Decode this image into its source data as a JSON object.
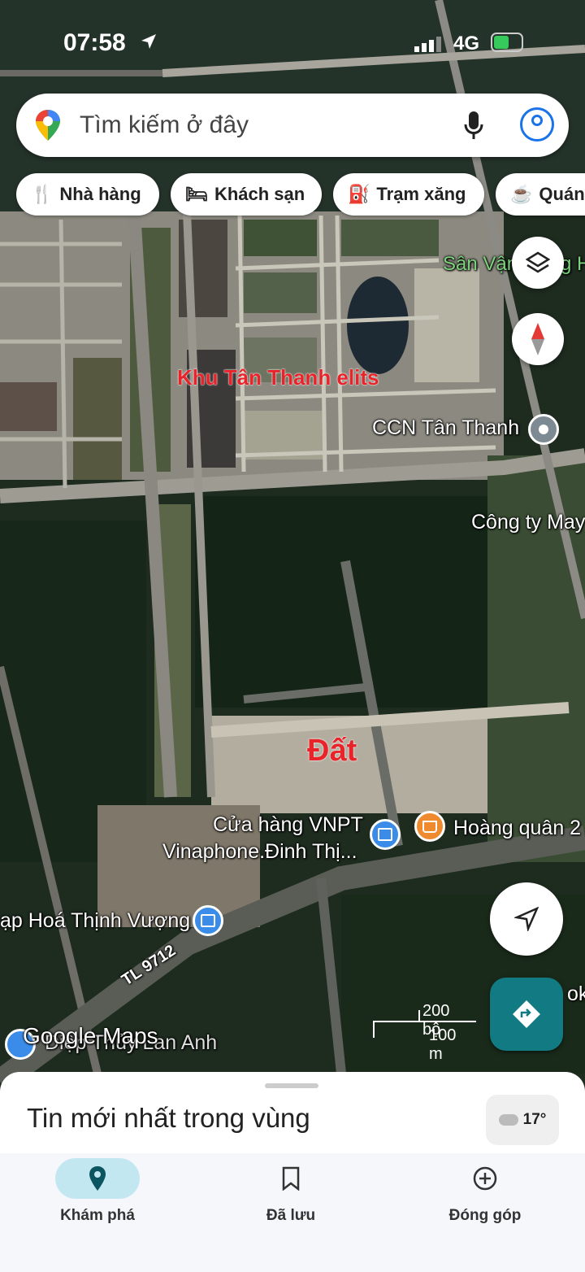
{
  "status_bar": {
    "time": "07:58",
    "network": "4G"
  },
  "search": {
    "placeholder": "Tìm kiếm ở đây"
  },
  "chips": [
    {
      "label": "Nhà hàng",
      "icon": "fork-knife-icon"
    },
    {
      "label": "Khách sạn",
      "icon": "bed-icon"
    },
    {
      "label": "Trạm xăng",
      "icon": "gas-station-icon"
    },
    {
      "label": "Quán",
      "icon": "coffee-cup-icon"
    }
  ],
  "map": {
    "labels": {
      "stadium": "Sân Vận",
      "stadium_tail": "g H",
      "khu": "Khu Tân Thanh elits",
      "ccn": "CCN Tân Thanh",
      "company": "Công ty May",
      "dat": "Đất",
      "vnpt_1": "Cửa hàng VNPT",
      "vnpt_2": "Vinaphone.Đinh Thị...",
      "hoang": "Hoàng quân 2",
      "taphoa": "ạp Hoá Thịnh Vượng",
      "road": "TL 9712",
      "google": "Google Maps",
      "thuy": "Diệp Thủy Lan Anh",
      "ok": "ok"
    },
    "scale_top": "200 bộ",
    "scale_bottom": "100 m"
  },
  "sheet": {
    "title": "Tin mới nhất trong vùng",
    "weather": "17°"
  },
  "nav": [
    {
      "label": "Khám phá"
    },
    {
      "label": "Đã lưu"
    },
    {
      "label": "Đóng góp"
    }
  ],
  "colors": {
    "accent": "#127a83",
    "nav_active": "#c3e7f1",
    "red_label": "#e8242a"
  }
}
